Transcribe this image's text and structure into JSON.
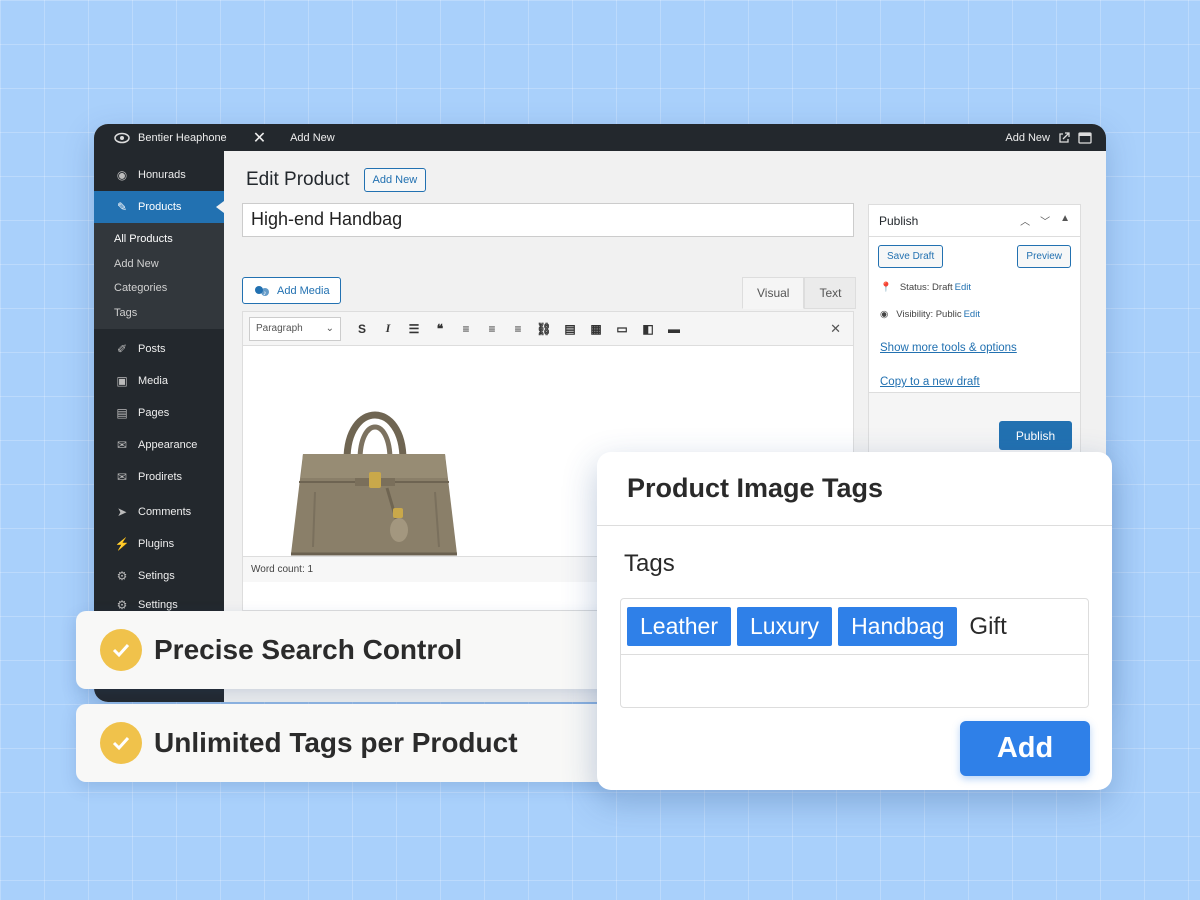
{
  "adminbar": {
    "site_name": "Bentier Heaphone",
    "add_new": "Add New",
    "right_add_new": "Add New"
  },
  "sidebar": {
    "items": [
      {
        "label": "Honurads",
        "icon": "dashboard-icon"
      },
      {
        "label": "Products",
        "icon": "pin-icon",
        "active": true
      },
      {
        "label": "Posts",
        "icon": "posts-icon"
      },
      {
        "label": "Media",
        "icon": "media-icon"
      },
      {
        "label": "Pages",
        "icon": "pages-icon"
      },
      {
        "label": "Appearance",
        "icon": "appearance-icon"
      },
      {
        "label": "Prodirets",
        "icon": "products-icon"
      },
      {
        "label": "Comments",
        "icon": "comments-icon"
      },
      {
        "label": "Plugins",
        "icon": "plugins-icon"
      },
      {
        "label": "Setings",
        "icon": "settings-icon"
      },
      {
        "label": "Settings",
        "icon": "settings-icon"
      }
    ],
    "submenu": [
      "All Products",
      "Add New",
      "Categories",
      "Tags"
    ]
  },
  "editor": {
    "page_title": "Edit Product",
    "add_new_button": "Add New",
    "product_title": "High-end Handbag",
    "add_media_button": "Add Media",
    "tab_visual": "Visual",
    "tab_text": "Text",
    "format_select": "Paragraph",
    "word_count": "Word count: 1"
  },
  "publish": {
    "title": "Publish",
    "save_draft": "Save Draft",
    "preview": "Preview",
    "status_label": "Status: Draft",
    "status_edit": "Edit",
    "visibility_label": "Visibility: Public",
    "visibility_edit": "Edit",
    "more_tools": "Show more tools & options",
    "copy_draft": "Copy to a new draft",
    "publish_button": "Publish"
  },
  "features": [
    "Precise Search Control",
    "Unlimited Tags per Product"
  ],
  "tags_card": {
    "title": "Product Image Tags",
    "label": "Tags",
    "chips": [
      "Leather",
      "Luxury",
      "Handbag"
    ],
    "pending_tag": "Gift",
    "add_button": "Add"
  },
  "colors": {
    "background": "#a9d0fb",
    "wp_dark": "#23282d",
    "wp_blue": "#2271b1",
    "tag_blue": "#2f80e8",
    "check_yellow": "#f0c24b"
  }
}
